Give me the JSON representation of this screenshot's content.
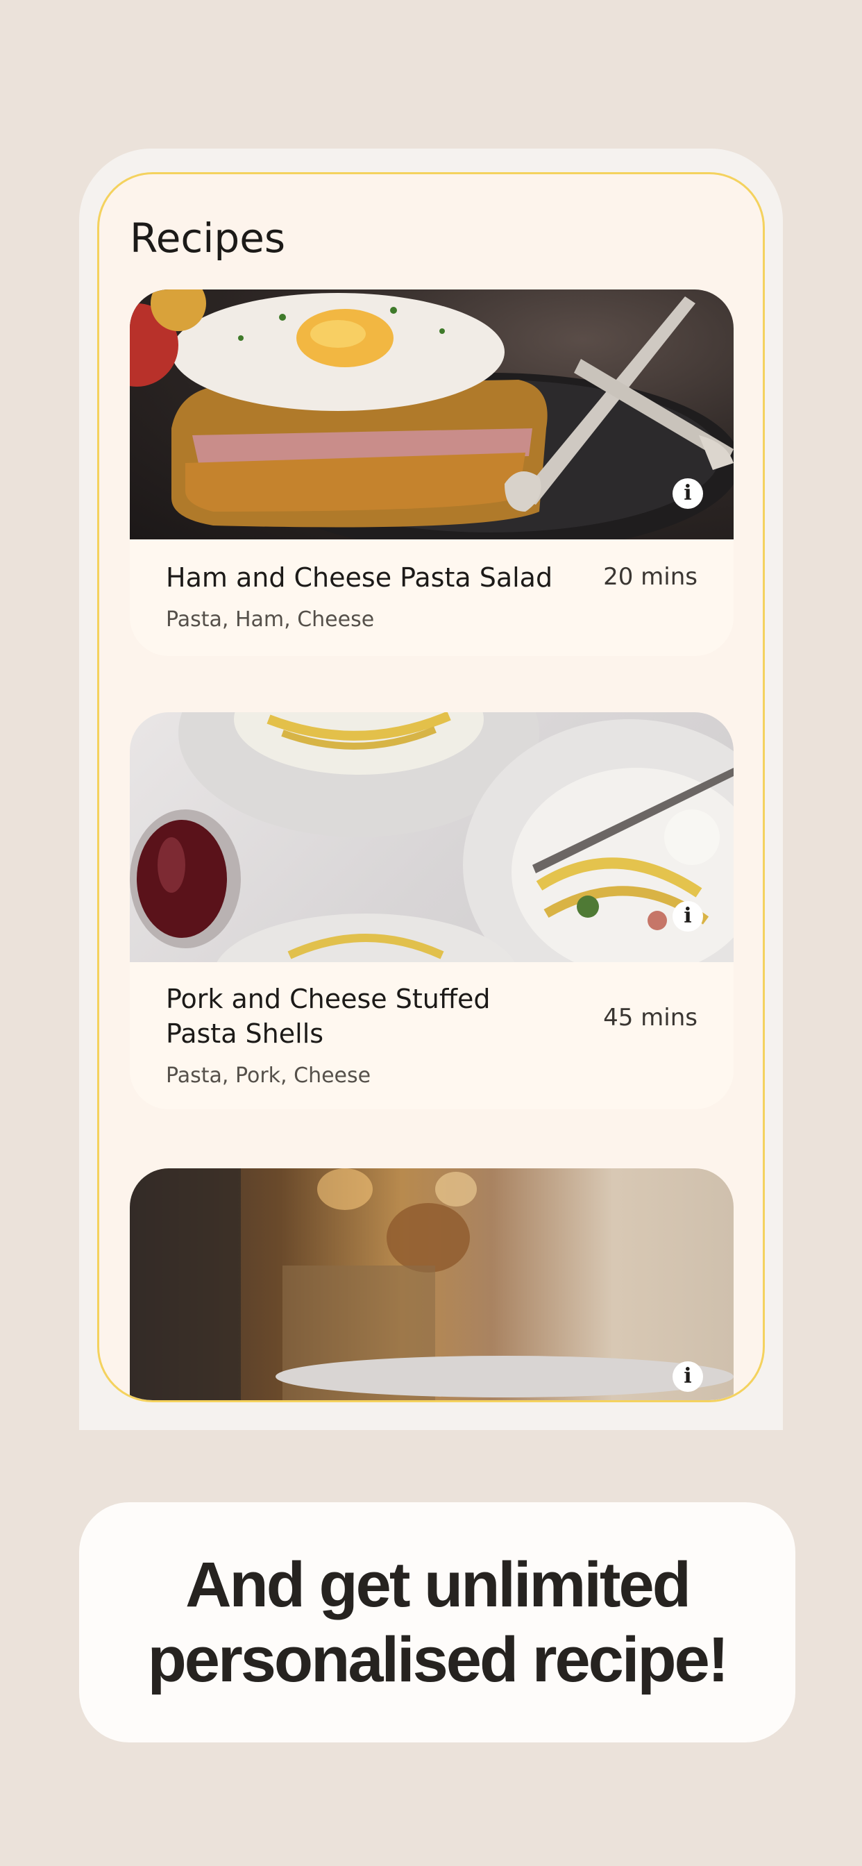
{
  "screen": {
    "title": "Recipes",
    "recipes": [
      {
        "name": "Ham and Cheese Pasta Salad",
        "time": "20 mins",
        "tags": "Pasta, Ham, Cheese",
        "info_icon": "info-icon",
        "info_label": "i"
      },
      {
        "name": "Pork and Cheese Stuffed Pasta Shells",
        "time": "45 mins",
        "tags": "Pasta, Pork, Cheese",
        "info_icon": "info-icon",
        "info_label": "i"
      },
      {
        "info_icon": "info-icon",
        "info_label": "i"
      }
    ]
  },
  "promo": {
    "line1": "And get unlimited",
    "line2": "personalised recipe!"
  },
  "colors": {
    "background": "#ebe2da",
    "screen_border": "#f4d25e",
    "screen_bg": "#fdf4ec",
    "card_bg": "#fff8f0",
    "text_dark": "#1c1a18"
  }
}
